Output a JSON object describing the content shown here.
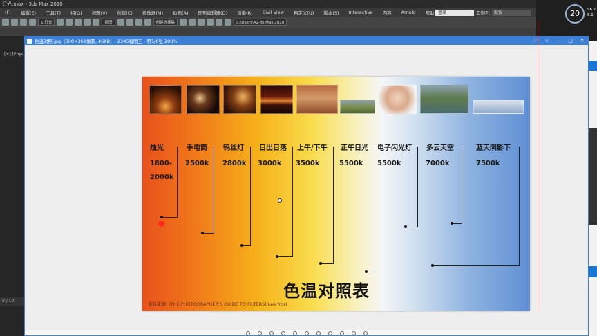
{
  "max": {
    "title": "灯光.max - 3ds Max 2020",
    "menus": [
      "(F)",
      "编辑(E)",
      "工具(T)",
      "组(G)",
      "视图(V)",
      "创建(C)",
      "修改器(M)",
      "动画(A)",
      "图形编辑器(D)",
      "渲染(R)",
      "Civil View",
      "自定义(U)",
      "脚本(S)",
      "Interactive",
      "内容",
      "Arnold",
      "帮助(H)"
    ],
    "login": "登录",
    "workspace_label": "工作区:",
    "workspace_value": "默认",
    "toolbar_select1": "1-灯光",
    "toolbar_select2": "视图",
    "toolbar_select3": "创建选择集",
    "toolbar_path": "C:\\Users\\A2-ds Max 2020",
    "view_label": "[+] [Phys",
    "timeline": "0 / 10"
  },
  "system": {
    "clock_value": "20",
    "stat1": "96.7",
    "stat2": "5.1"
  },
  "viewer": {
    "title": "色温对照.jpg（600×361像素, 46KB）- 2345看图王 - 第5/6张 200%",
    "controls": [
      "♡",
      "☆",
      "—",
      "□",
      "✕"
    ]
  },
  "chart_data": {
    "type": "table",
    "title": "色温对照表",
    "source": "资料来源: (THE PHOTOGRAPHER'S GUIDE TO FILTERS)  Lee frost",
    "categories": [
      "烛光",
      "手电筒",
      "钨丝灯",
      "日出日落",
      "上午/下午",
      "正午日光",
      "电子闪光灯",
      "多云天空",
      "蓝天阴影下"
    ],
    "values_line1": [
      "1800-",
      "2500k",
      "2800k",
      "3000k",
      "3500k",
      "5500k",
      "5500k",
      "7000k",
      "7500k"
    ],
    "values_line2": [
      "2000k"
    ]
  }
}
